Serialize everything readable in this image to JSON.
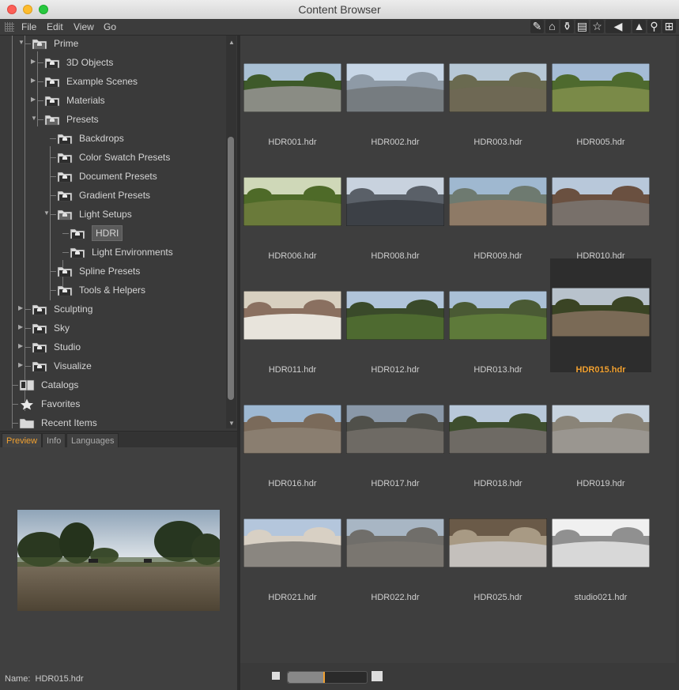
{
  "window": {
    "title": "Content Browser"
  },
  "menu": [
    "File",
    "Edit",
    "View",
    "Go"
  ],
  "toolbar_icons": [
    "pencil-icon",
    "home-icon",
    "jar-icon",
    "book-icon",
    "star-icon",
    "back-arrow-icon",
    "up-arrow-icon",
    "search-icon",
    "add-icon"
  ],
  "tree": {
    "root": "Prime",
    "prime_children": [
      "3D Objects",
      "Example Scenes",
      "Materials",
      "Presets"
    ],
    "presets_children": [
      "Backdrops",
      "Color Swatch Presets",
      "Document Presets",
      "Gradient Presets",
      "Light Setups"
    ],
    "light_children": [
      "HDRI",
      "Light Environments"
    ],
    "presets_tail": [
      "Spline Presets",
      "Tools & Helpers"
    ],
    "prime_tail": [
      "Sculpting",
      "Sky",
      "Studio",
      "Visualize"
    ],
    "top_level": [
      "Catalogs",
      "Favorites",
      "Recent Items"
    ],
    "selected": "HDRI"
  },
  "tabs": [
    "Preview",
    "Info",
    "Languages"
  ],
  "preview": {
    "name_label": "Name:",
    "name_value": "HDR015.hdr"
  },
  "grid": {
    "items": [
      "HDR001.hdr",
      "HDR002.hdr",
      "HDR003.hdr",
      "HDR005.hdr",
      "HDR006.hdr",
      "HDR008.hdr",
      "HDR009.hdr",
      "HDR010.hdr",
      "HDR011.hdr",
      "HDR012.hdr",
      "HDR013.hdr",
      "HDR015.hdr",
      "HDR016.hdr",
      "HDR017.hdr",
      "HDR018.hdr",
      "HDR019.hdr",
      "HDR021.hdr",
      "HDR022.hdr",
      "HDR025.hdr",
      "studio021.hdr"
    ],
    "selected": "HDR015.hdr"
  },
  "zoom": {
    "level": 0.45
  },
  "colors": {
    "accent": "#f0a030",
    "background": "#3e3e3e"
  }
}
